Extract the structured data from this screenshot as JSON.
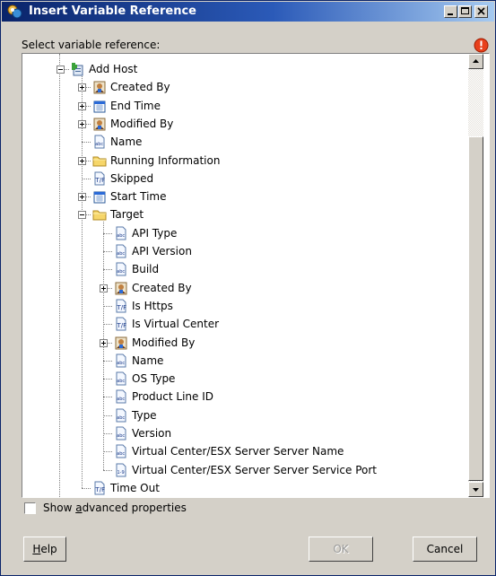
{
  "window": {
    "title": "Insert Variable Reference",
    "icon": "workflow-variable-icon"
  },
  "prompt": "Select variable reference:",
  "tree": {
    "items": [
      {
        "label": "Add Host",
        "level": 0,
        "icon": "action",
        "expander": "minus"
      },
      {
        "label": "Created By",
        "level": 1,
        "icon": "user",
        "expander": "plus"
      },
      {
        "label": "End Time",
        "level": 1,
        "icon": "calendar",
        "expander": "plus"
      },
      {
        "label": "Modified By",
        "level": 1,
        "icon": "user",
        "expander": "plus"
      },
      {
        "label": "Name",
        "level": 1,
        "icon": "abc",
        "expander": "none"
      },
      {
        "label": "Running Information",
        "level": 1,
        "icon": "folder",
        "expander": "plus"
      },
      {
        "label": "Skipped",
        "level": 1,
        "icon": "bool",
        "expander": "none"
      },
      {
        "label": "Start Time",
        "level": 1,
        "icon": "calendar",
        "expander": "plus"
      },
      {
        "label": "Target",
        "level": 1,
        "icon": "folder",
        "expander": "minus"
      },
      {
        "label": "API Type",
        "level": 2,
        "icon": "abc",
        "expander": "none"
      },
      {
        "label": "API Version",
        "level": 2,
        "icon": "abc",
        "expander": "none"
      },
      {
        "label": "Build",
        "level": 2,
        "icon": "abc",
        "expander": "none"
      },
      {
        "label": "Created By",
        "level": 2,
        "icon": "user",
        "expander": "plus"
      },
      {
        "label": "Is Https",
        "level": 2,
        "icon": "bool",
        "expander": "none"
      },
      {
        "label": "Is Virtual Center",
        "level": 2,
        "icon": "bool",
        "expander": "none"
      },
      {
        "label": "Modified By",
        "level": 2,
        "icon": "user",
        "expander": "plus"
      },
      {
        "label": "Name",
        "level": 2,
        "icon": "abc",
        "expander": "none"
      },
      {
        "label": "OS Type",
        "level": 2,
        "icon": "abc",
        "expander": "none"
      },
      {
        "label": "Product Line ID",
        "level": 2,
        "icon": "abc",
        "expander": "none"
      },
      {
        "label": "Type",
        "level": 2,
        "icon": "abc",
        "expander": "none"
      },
      {
        "label": "Version",
        "level": 2,
        "icon": "abc",
        "expander": "none"
      },
      {
        "label": "Virtual Center/ESX Server Server Name",
        "level": 2,
        "icon": "abc",
        "expander": "none"
      },
      {
        "label": "Virtual Center/ESX Server Server Service Port",
        "level": 2,
        "icon": "number",
        "expander": "none"
      },
      {
        "label": "Time Out",
        "level": 1,
        "icon": "bool",
        "expander": "none"
      }
    ]
  },
  "checkbox": {
    "label_pre": "Show ",
    "label_accel": "a",
    "label_post": "dvanced properties",
    "checked": false
  },
  "buttons": {
    "help_accel": "H",
    "help_rest": "elp",
    "ok": "OK",
    "cancel": "Cancel"
  },
  "colors": {
    "title_start": "#0a246a",
    "title_end": "#a6caf0",
    "dialog_bg": "#d4d0c8"
  }
}
